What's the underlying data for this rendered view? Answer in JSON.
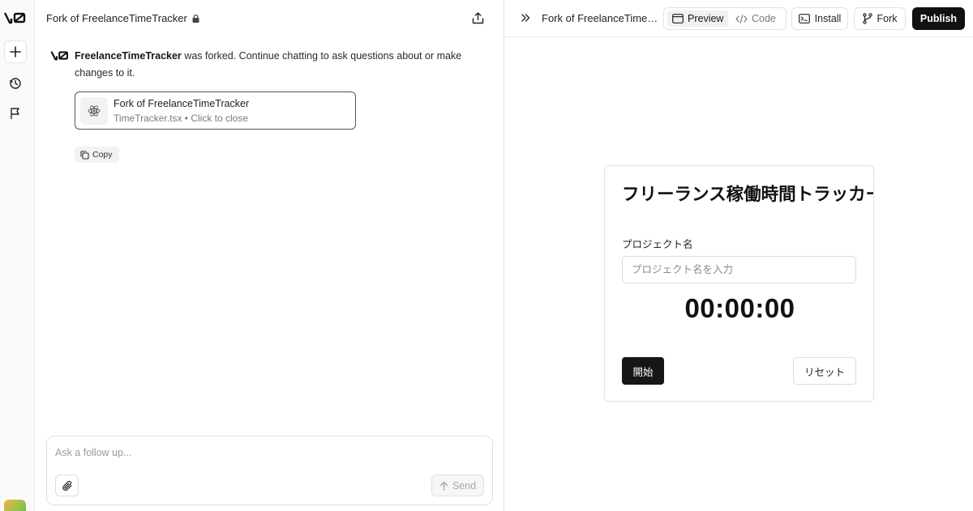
{
  "rail": {
    "icons": [
      "v0-logo-icon",
      "plus-icon",
      "history-icon",
      "flag-icon"
    ]
  },
  "chat": {
    "header_title": "Fork of FreelanceTimeTracker",
    "message": {
      "project_name": "FreelanceTimeTracker",
      "text": " was forked. Continue chatting to ask questions about or make changes to it."
    },
    "file_card": {
      "name": "Fork of FreelanceTimeTracker",
      "subtitle": "TimeTracker.tsx • Click to close"
    },
    "copy_label": "Copy",
    "composer": {
      "placeholder": "Ask a follow up...",
      "value": "",
      "send_label": "Send"
    }
  },
  "preview": {
    "title": "Fork of FreelanceTimeTracker",
    "tabs": [
      {
        "label": "Preview",
        "active": true
      },
      {
        "label": "Code",
        "active": false
      }
    ],
    "install_label": "Install",
    "fork_label": "Fork",
    "publish_label": "Publish"
  },
  "app": {
    "title": "フリーランス稼働時間トラッカー",
    "project_label": "プロジェクト名",
    "project_placeholder": "プロジェクト名を入力",
    "project_value": "",
    "timer": "00:00:00",
    "start_label": "開始",
    "reset_label": "リセット"
  },
  "colors": {
    "accent": "#111111",
    "border": "#e3e3e3",
    "muted_text": "#7a7a7a"
  }
}
